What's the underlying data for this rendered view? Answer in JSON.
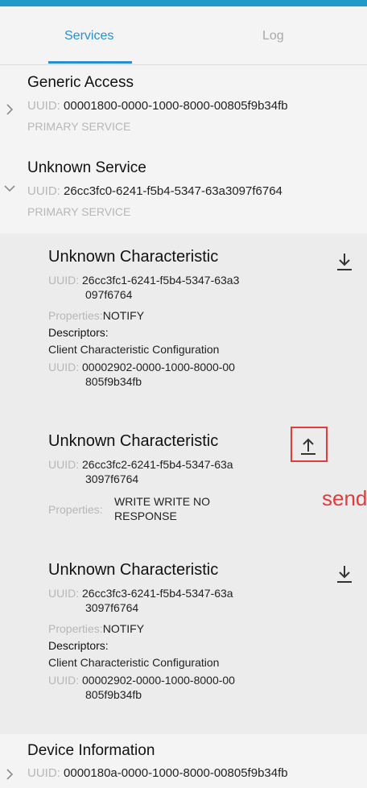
{
  "tabs": {
    "services": "Services",
    "log": "Log"
  },
  "services": [
    {
      "name": "Generic Access",
      "uuid_label": "UUID:",
      "uuid_value": "00001800-0000-1000-8000-00805f9b34fb",
      "type": "PRIMARY SERVICE"
    },
    {
      "name": "Unknown Service",
      "uuid_label": "UUID:",
      "uuid_value": "26cc3fc0-6241-f5b4-5347-63a3097f6764",
      "type": "PRIMARY SERVICE"
    },
    {
      "name": "Device Information",
      "uuid_label": "UUID:",
      "uuid_value": "0000180a-0000-1000-8000-00805f9b34fb"
    }
  ],
  "characteristics": [
    {
      "name": "Unknown Characteristic",
      "uuid_label": "UUID:",
      "uuid_part1": "26cc3fc1-6241-f5b4-5347-63a3",
      "uuid_part2": "097f6764",
      "properties_label": "Properties:",
      "properties_value": "NOTIFY",
      "descriptors_label": "Descriptors:",
      "descriptor_name": "Client Characteristic Configuration",
      "descriptor_uuid_label": "UUID:",
      "descriptor_uuid_part1": "00002902-0000-1000-8000-00",
      "descriptor_uuid_part2": "805f9b34fb"
    },
    {
      "name": "Unknown Characteristic",
      "uuid_label": "UUID:",
      "uuid_part1": "26cc3fc2-6241-f5b4-5347-63a",
      "uuid_part2": "3097f6764",
      "properties_label": "Properties:",
      "properties_line1": "WRITE WRITE NO",
      "properties_line2": "RESPONSE"
    },
    {
      "name": "Unknown Characteristic",
      "uuid_label": "UUID:",
      "uuid_part1": "26cc3fc3-6241-f5b4-5347-63a",
      "uuid_part2": "3097f6764",
      "properties_label": "Properties:",
      "properties_value": "NOTIFY",
      "descriptors_label": "Descriptors:",
      "descriptor_name": "Client Characteristic Configuration",
      "descriptor_uuid_label": "UUID:",
      "descriptor_uuid_part1": "00002902-0000-1000-8000-00",
      "descriptor_uuid_part2": "805f9b34fb"
    }
  ],
  "annotation": {
    "send_label": "send"
  },
  "icons": {
    "download": "download-icon",
    "upload": "upload-icon",
    "chevron_right": "chevron-right-icon",
    "chevron_down": "chevron-down-icon"
  },
  "colors": {
    "tab_active": "#2a8fd0",
    "tab_inactive": "#a9a9a9",
    "accent_bar": "#1f9ac9",
    "annotation_red": "#e23b3b"
  }
}
